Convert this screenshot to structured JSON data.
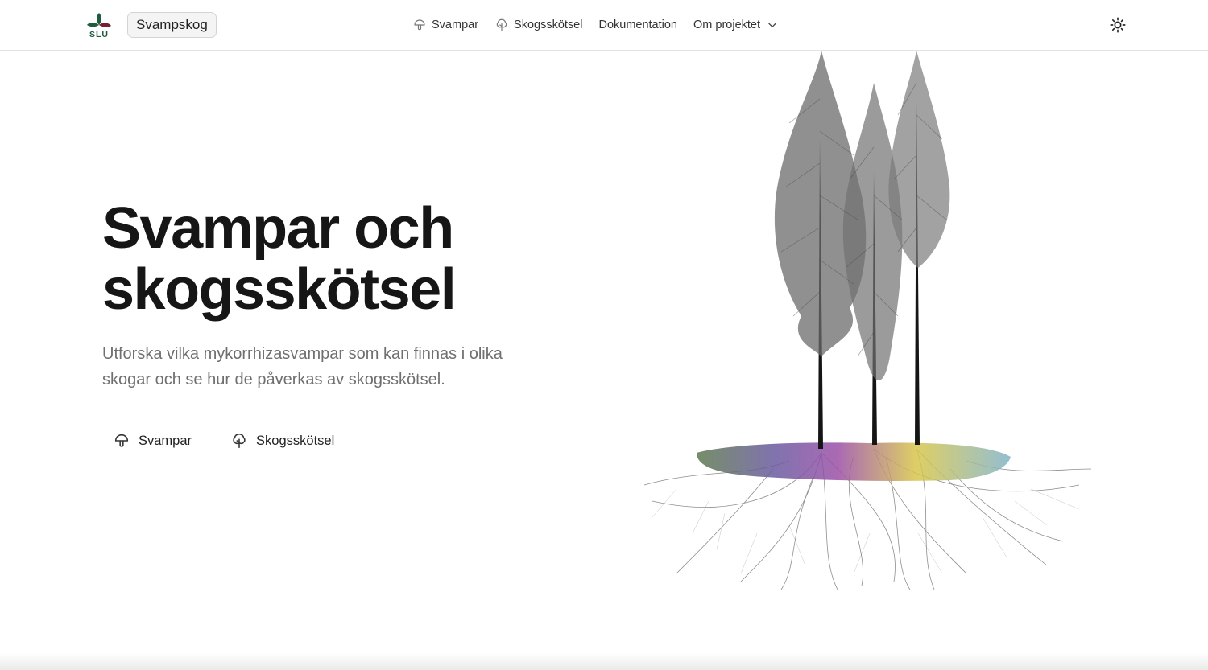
{
  "header": {
    "logo_label": "SLU",
    "brand": "Svampskog",
    "nav": [
      {
        "label": "Svampar",
        "icon": "mushroom-icon"
      },
      {
        "label": "Skogsskötsel",
        "icon": "tree-icon"
      },
      {
        "label": "Dokumentation"
      },
      {
        "label": "Om projektet",
        "icon": "chevron-down-icon"
      }
    ],
    "theme_icon": "sun-icon"
  },
  "hero": {
    "title_line1": "Svampar och",
    "title_line2": "skogsskötsel",
    "subtitle": "Utforska vilka mykorrhizasvampar som kan finnas i olika skogar och se hur de påverkas av skogsskötsel.",
    "buttons": [
      {
        "label": "Svampar",
        "icon": "mushroom-icon"
      },
      {
        "label": "Skogsskötsel",
        "icon": "tree-icon"
      }
    ]
  },
  "colors": {
    "logo_green": "#1f5c3d",
    "logo_red": "#7a1f2e",
    "soil_purple": "#9b4fa6",
    "soil_yellow": "#d8c64a",
    "soil_blue": "#7fb3c9",
    "soil_green": "#5d7a4e"
  }
}
